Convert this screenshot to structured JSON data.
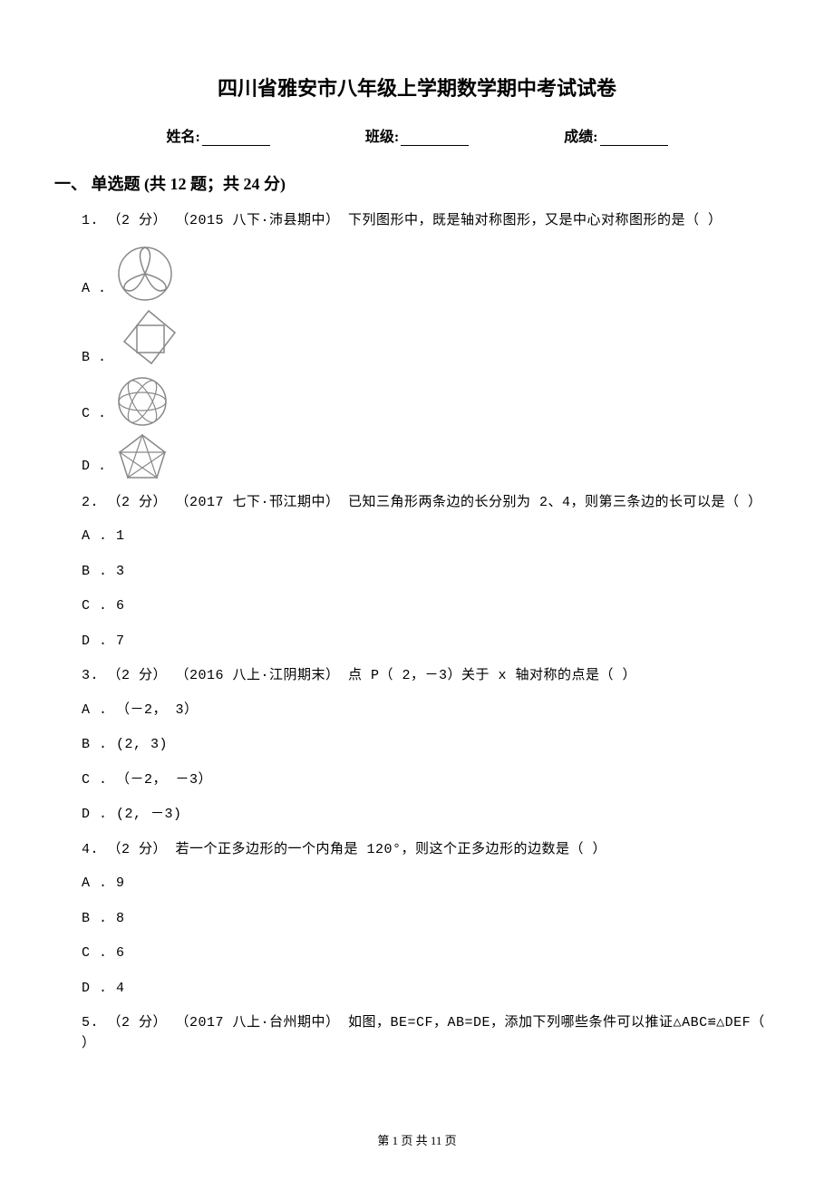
{
  "title": "四川省雅安市八年级上学期数学期中考试试卷",
  "header": {
    "name_label": "姓名:",
    "class_label": "班级:",
    "score_label": "成绩:"
  },
  "section": "一、 单选题 (共 12 题；共 24 分)",
  "questions": {
    "q1": {
      "text": "1.  （2 分） （2015 八下·沛县期中） 下列图形中，既是轴对称图形，又是中心对称图形的是（    ）",
      "options": {
        "a": "A .",
        "b": "B .",
        "c": "C .",
        "d": "D ."
      }
    },
    "q2": {
      "text": "2.  （2 分） （2017 七下·邗江期中） 已知三角形两条边的长分别为 2、4，则第三条边的长可以是（    ）",
      "options": {
        "a": "A . 1",
        "b": "B . 3",
        "c": "C . 6",
        "d": "D . 7"
      }
    },
    "q3": {
      "text": "3.  （2 分） （2016 八上·江阴期末） 点 P（ 2，－3）关于 x 轴对称的点是（    ）",
      "options": {
        "a": "A . （－2， 3）",
        "b": "B .  (2, 3)",
        "c": "C . （－2， －3）",
        "d": "D .  (2, －3)"
      }
    },
    "q4": {
      "text": "4.  （2 分）  若一个正多边形的一个内角是 120°，则这个正多边形的边数是（    ）",
      "options": {
        "a": "A . 9",
        "b": "B . 8",
        "c": "C . 6",
        "d": "D . 4"
      }
    },
    "q5": {
      "text": "5.  （2 分） （2017 八上·台州期中） 如图，BE=CF，AB=DE，添加下列哪些条件可以推证△ABC≌△DEF（    ）"
    }
  },
  "footer": "第 1 页 共 11 页"
}
